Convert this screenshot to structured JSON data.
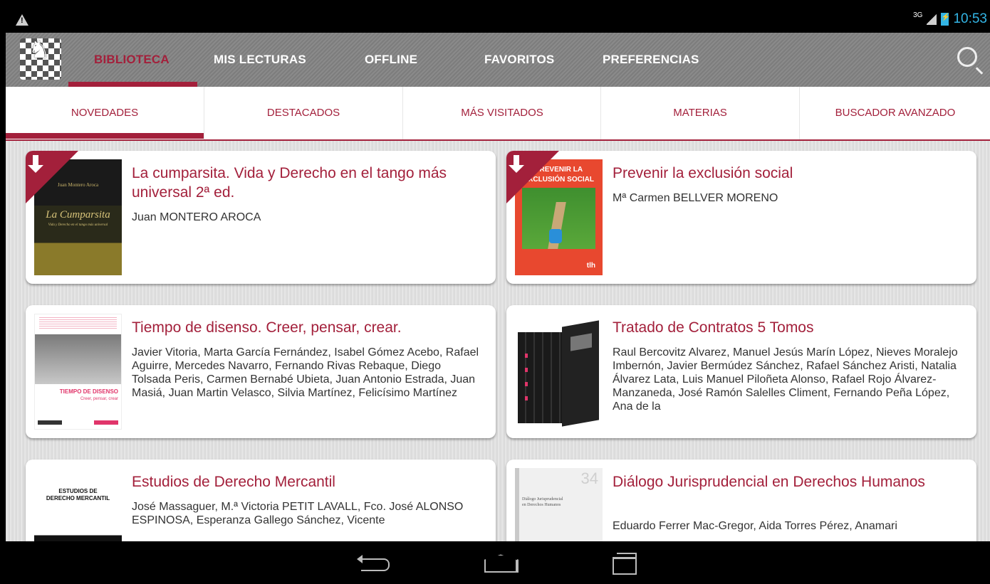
{
  "status": {
    "network": "3G",
    "time": "10:53"
  },
  "nav": {
    "tabs": [
      {
        "label": "BIBLIOTECA",
        "active": true
      },
      {
        "label": "MIS LECTURAS"
      },
      {
        "label": "OFFLINE"
      },
      {
        "label": "FAVORITOS"
      },
      {
        "label": "PREFERENCIAS"
      }
    ]
  },
  "subnav": {
    "tabs": [
      {
        "label": "NOVEDADES",
        "active": true
      },
      {
        "label": "DESTACADOS"
      },
      {
        "label": "MÁS VISITADOS"
      },
      {
        "label": "MATERIAS"
      },
      {
        "label": "BUSCADOR AVANZADO"
      }
    ]
  },
  "books": [
    {
      "title": "La cumparsita. Vida y Derecho en el tango más universal 2ª ed.",
      "authors": "Juan MONTERO AROCA",
      "cover_lines": [
        "Juan Montero Aroca",
        "La Cumparsita",
        "Vida y Derecho en el tango más universal"
      ],
      "downloaded": true
    },
    {
      "title": "Prevenir la exclusión social",
      "authors": "Mª Carmen BELLVER MORENO",
      "cover_lines": [
        "PREVENIR LA EXCLUSIÓN SOCIAL",
        "tlh"
      ],
      "downloaded": true
    },
    {
      "title": "Tiempo de disenso. Creer, pensar, crear.",
      "authors": " Javier Vitoria,  Marta García Fernández,  Isabel Gómez Acebo, Rafael Aguirre,  Mercedes Navarro,  Fernando Rivas Rebaque, Diego Tolsada Peris,  Carmen Bernabé Ubieta,  Juan Antonio Estrada,  Juan Masiá,  Juan Martin Velasco, Silvia Martínez,  Felicísimo Martínez",
      "cover_lines": [
        "TIEMPO DE DISENSO",
        "Creer, pensar, crear"
      ],
      "downloaded": false
    },
    {
      "title": "Tratado de Contratos 5 Tomos",
      "authors": " Raul Bercovitz Alvarez, Manuel Jesús Marín López, Nieves Moralejo Imbernón,  Javier Bermúdez Sánchez, Rafael Sánchez Aristi, Natalia Álvarez Lata, Luis Manuel Piloñeta Alonso, Rafael Rojo Álvarez-Manzaneda,  José Ramón Salelles Climent, Fernando Peña López, Ana de la",
      "cover_lines": [],
      "downloaded": false
    },
    {
      "title": "Estudios de Derecho Mercantil",
      "authors": "José Massaguer, M.ª Victoria PETIT LAVALL, Fco. José ALONSO ESPINOSA, Esperanza Gallego Sánchez, Vicente",
      "cover_lines": [
        "ESTUDIOS DE",
        "DERECHO MERCANTIL"
      ],
      "downloaded": false
    },
    {
      "title": "Diálogo Jurisprudencial en Derechos Humanos",
      "authors": " Eduardo Ferrer Mac-Gregor, Aida Torres Pérez, Anamari",
      "cover_lines": [
        "34",
        "Diálogo Jurisprudencial en Derechos Humanos"
      ],
      "downloaded": false
    }
  ]
}
